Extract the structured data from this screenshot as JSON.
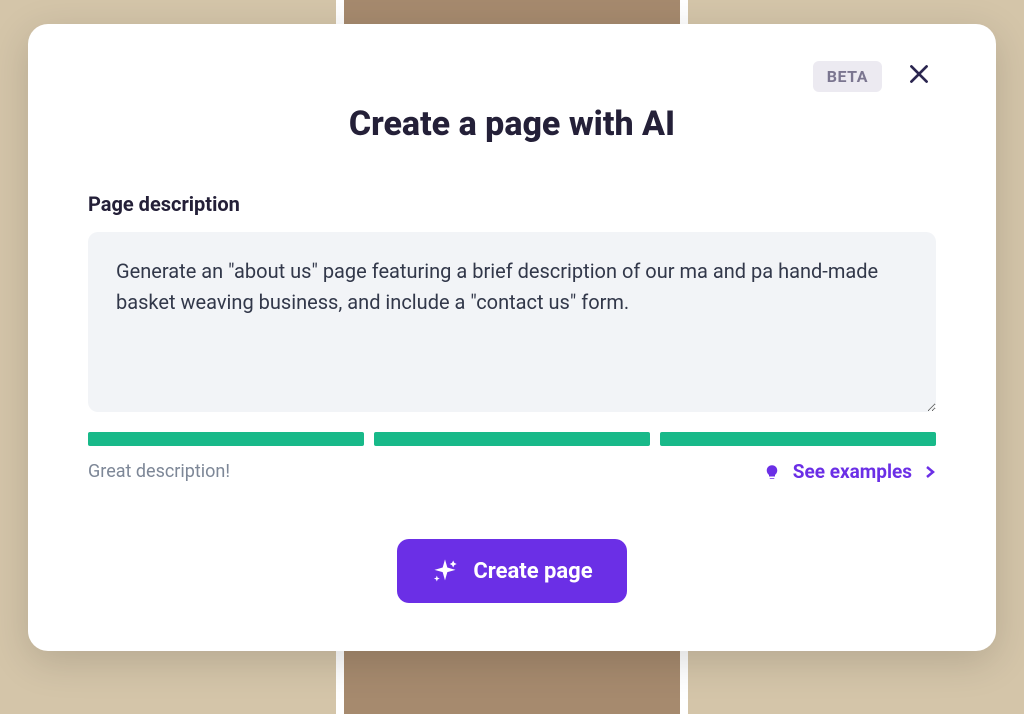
{
  "modal": {
    "beta_label": "BETA",
    "title": "Create a page with AI",
    "field_label": "Page description",
    "textarea_value": "Generate an \"about us\" page featuring a brief description of our ma and pa hand-made basket weaving business, and include a \"contact us\" form.",
    "strength": {
      "segments": 3,
      "filled": 3,
      "color": "#18b989"
    },
    "feedback": "Great description!",
    "examples_label": "See examples",
    "cta_label": "Create page"
  },
  "colors": {
    "accent": "#6b2fe6",
    "success": "#18b989",
    "badge_bg": "#eceaf1",
    "badge_fg": "#7b7690",
    "text": "#242038",
    "muted": "#7d8797"
  }
}
